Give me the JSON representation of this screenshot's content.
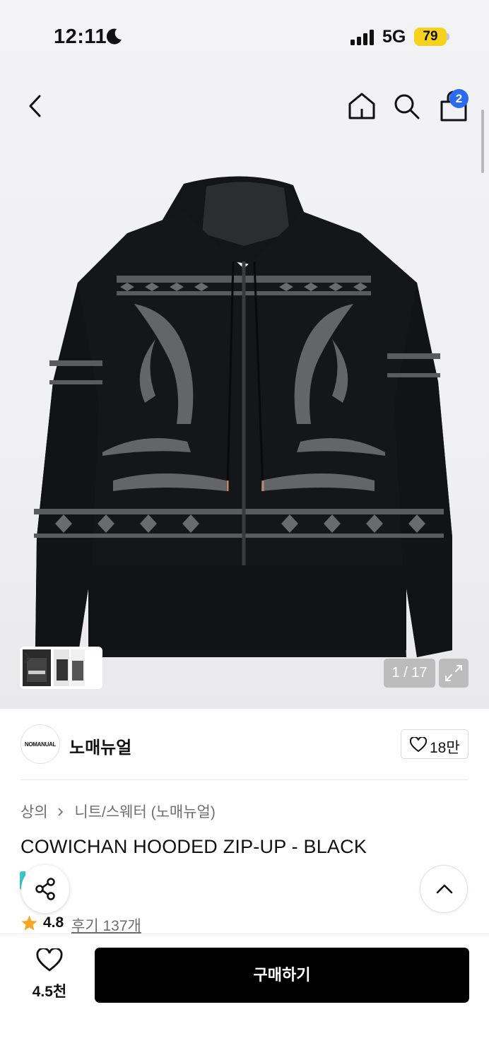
{
  "status_bar": {
    "time": "12:11",
    "network": "5G",
    "battery": "79"
  },
  "nav": {
    "cart_count": "2"
  },
  "gallery": {
    "counter": "1 / 17"
  },
  "brand": {
    "logo_text": "NOMANUAL",
    "name": "노매뉴얼",
    "like_count": "18만"
  },
  "breadcrumb": {
    "category": "상의",
    "subcategory": "니트/스웨터 (노매뉴얼)"
  },
  "product": {
    "title": "COWICHAN HOODED ZIP-UP - BLACK",
    "rating": "4.8",
    "reviews_label": "후기 137개"
  },
  "bottom_bar": {
    "wish_count": "4.5천",
    "buy_label": "구매하기"
  },
  "colors": {
    "accent_blue": "#2b6bf2",
    "battery_yellow": "#f4d21d",
    "teal": "#3bc6c9",
    "star": "#f5a623"
  }
}
